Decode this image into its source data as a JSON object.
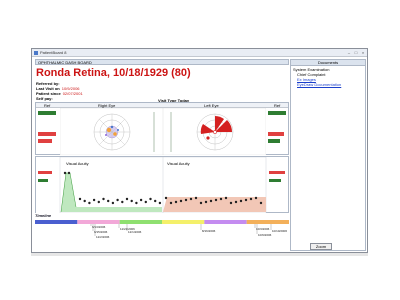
{
  "window": {
    "title": "PatientBoard 8"
  },
  "dashboard": {
    "title": "OPHTHALMIC DASH BOARD"
  },
  "patient": {
    "name_line": "Ronda Retina, 10/18/1929 (80)",
    "referred_by_label": "Referred by",
    "last_visit_label": "Last Visit on",
    "last_visit_value": "10/9/2006",
    "patient_since_label": "Patient since",
    "patient_since_value": "02/07/2001",
    "self_pay_label": "Self pay"
  },
  "visit_type": {
    "label": "Visit Type Today"
  },
  "eye_panel": {
    "ref_left": "Ref",
    "right_eye": "Right Eye",
    "left_eye": "Left Eye",
    "ref_right": "Ref"
  },
  "visual_acuity": {
    "left_title": "Visual Acuity",
    "right_title": "Visual Acuity"
  },
  "timeline": {
    "label": "Timeline",
    "dates": [
      "9/13/2006",
      "11/21/2006",
      "9/15/2006",
      "12/1/2006",
      "12/2/2006",
      "8/16/2006",
      "10/3/2006",
      "10/10/2006",
      "10/9/2006"
    ],
    "segment_colors": [
      "#4a5fd0",
      "#f2a8d8",
      "#8fe070",
      "#f4f06a",
      "#c48cf0",
      "#f3b05a"
    ]
  },
  "documents": {
    "header": "Documents",
    "items": [
      {
        "label": "System Examination",
        "link": false
      },
      {
        "label": "Chief Complaint",
        "link": false
      },
      {
        "label": "Ex Images",
        "link": true
      },
      {
        "label": "EyeDraw Documentation",
        "link": true
      }
    ]
  },
  "footer": {
    "page_button": "Zoom"
  },
  "colors": {
    "name": "#cc1414",
    "link": "#1a3fcc",
    "ref_green": "#2e7d32",
    "ref_red": "#e04040",
    "va_right_fill": "#bfe8bf",
    "va_left_fill": "#f2c7b6",
    "va_points": "#222222"
  }
}
